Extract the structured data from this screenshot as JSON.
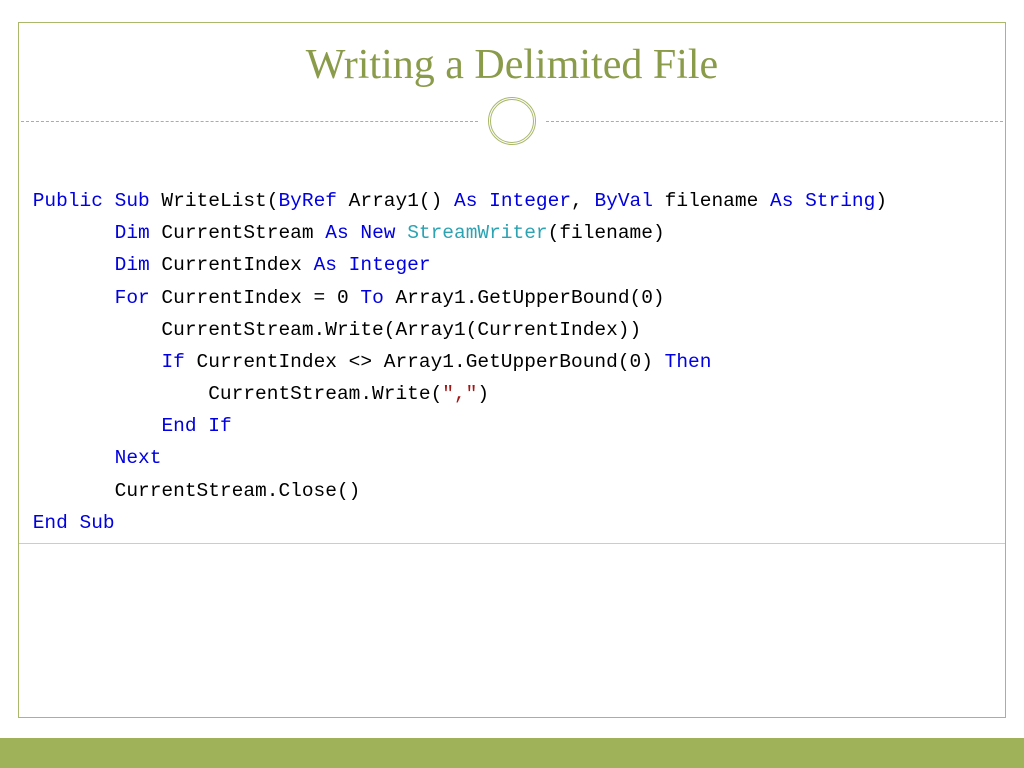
{
  "title": "Writing a Delimited File",
  "code": {
    "l1a": "Public",
    "l1b": "Sub",
    "l1c": " WriteList(",
    "l1d": "ByRef",
    "l1e": " Array1() ",
    "l1f": "As",
    "l1g": "Integer",
    "l1h": ", ",
    "l1i": "ByVal",
    "l1j": " filename ",
    "l1k": "As",
    "l1l": "String",
    "l1m": ")",
    "l2a": "Dim",
    "l2b": " CurrentStream ",
    "l2c": "As",
    "l2d": "New",
    "l2e": "StreamWriter",
    "l2f": "(filename)",
    "l3a": "Dim",
    "l3b": " CurrentIndex ",
    "l3c": "As",
    "l3d": "Integer",
    "l4a": "For",
    "l4b": " CurrentIndex = 0 ",
    "l4c": "To",
    "l4d": " Array1.GetUpperBound(0)",
    "l5": "            CurrentStream.Write(Array1(CurrentIndex))",
    "l6a": "If",
    "l6b": " CurrentIndex <> Array1.GetUpperBound(0) ",
    "l6c": "Then",
    "l7a": "                CurrentStream.Write(",
    "l7b": "\",\"",
    "l7c": ")",
    "l8a": "End",
    "l8b": "If",
    "l9": "Next",
    "l10": "        CurrentStream.Close()",
    "l11a": "End",
    "l11b": "Sub"
  }
}
